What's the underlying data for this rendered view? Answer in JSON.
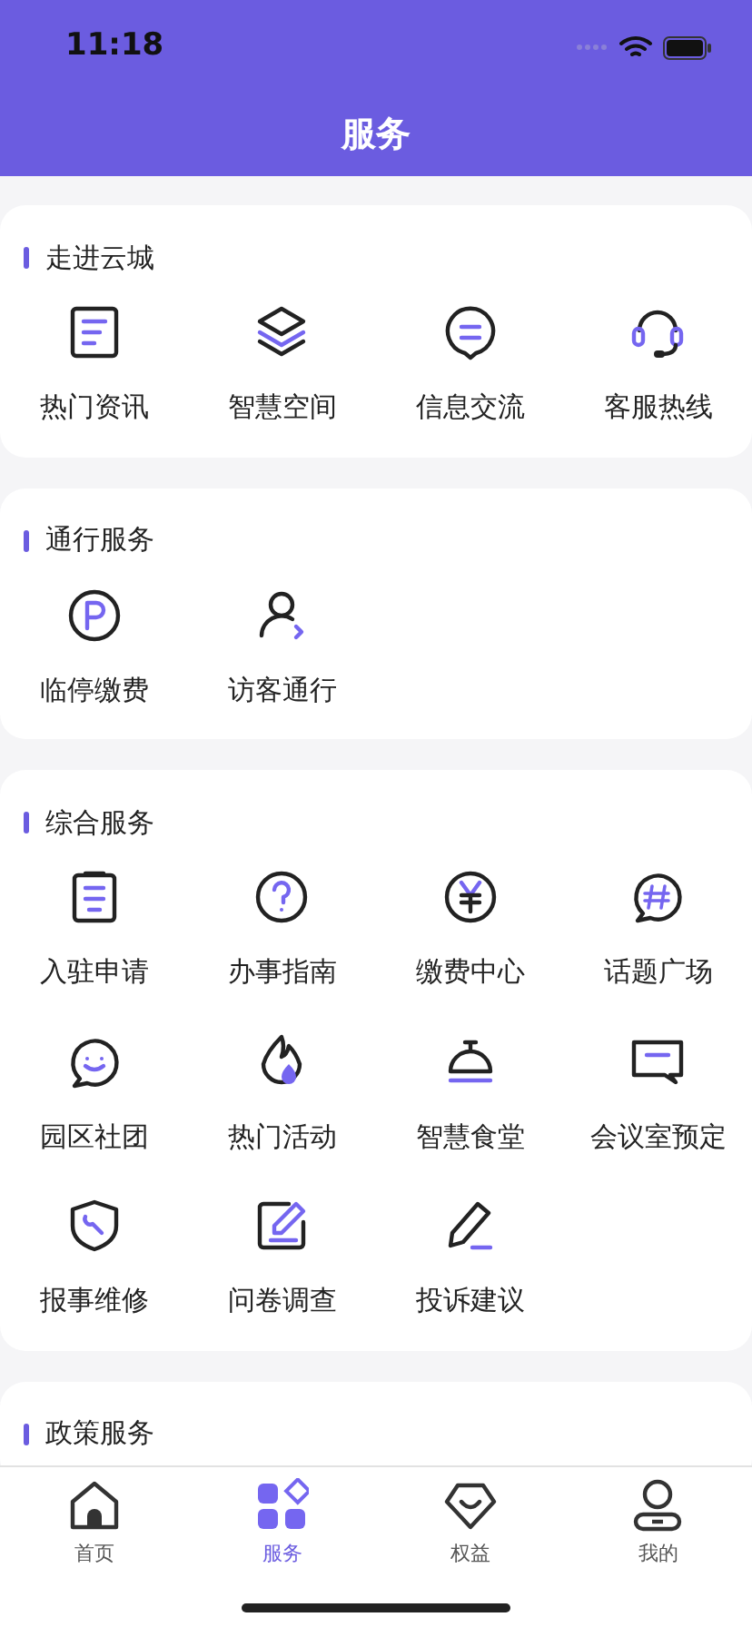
{
  "status_bar": {
    "time": "11:18"
  },
  "header": {
    "title": "服务"
  },
  "sections": [
    {
      "title": "走进云城",
      "items": [
        "热门资讯",
        "智慧空间",
        "信息交流",
        "客服热线"
      ]
    },
    {
      "title": "通行服务",
      "items": [
        "临停缴费",
        "访客通行"
      ]
    },
    {
      "title": "综合服务",
      "items": [
        "入驻申请",
        "办事指南",
        "缴费中心",
        "话题广场",
        "园区社团",
        "热门活动",
        "智慧食堂",
        "会议室预定",
        "报事维修",
        "问卷调查",
        "投诉建议"
      ]
    },
    {
      "title": "政策服务"
    }
  ],
  "tab_bar": [
    {
      "label": "首页",
      "selected": false
    },
    {
      "label": "服务",
      "selected": true
    },
    {
      "label": "权益",
      "selected": false
    },
    {
      "label": "我的",
      "selected": false
    }
  ]
}
